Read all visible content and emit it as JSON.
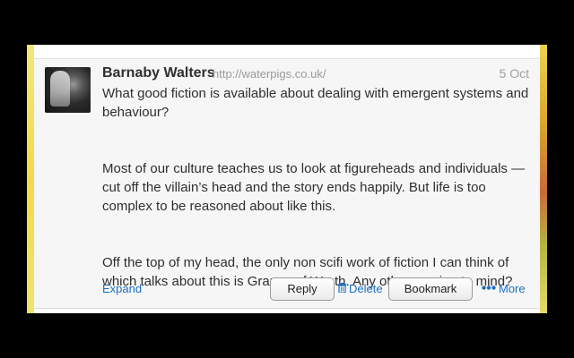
{
  "tweet": {
    "author_name": "Barnaby Walters",
    "author_url": "http://waterpigs.co.uk/",
    "date": "5 Oct",
    "paragraphs": [
      "What good fiction is available about dealing with emergent systems and behaviour?",
      "Most of our culture teaches us to look at figureheads and individuals — cut off the villain’s head and the story ends happily. But life is too complex to be reasoned about like this.",
      "Off the top of my head, the only non scifi work of fiction I can think of which talks about this is Grapes of Wrath. Any others spring to mind?"
    ]
  },
  "actions": {
    "expand_label": "Expand",
    "reply_label": "Reply",
    "delete_label": "Delete",
    "bookmark_label": "Bookmark",
    "more_label": "More"
  },
  "icons": {
    "delete": "trash-icon",
    "more": "ellipsis-icon"
  },
  "colors": {
    "link": "#1a6fc2",
    "text": "#2f2f2f",
    "muted": "#9a9a9a",
    "card_bg": "#f6f6f6"
  }
}
